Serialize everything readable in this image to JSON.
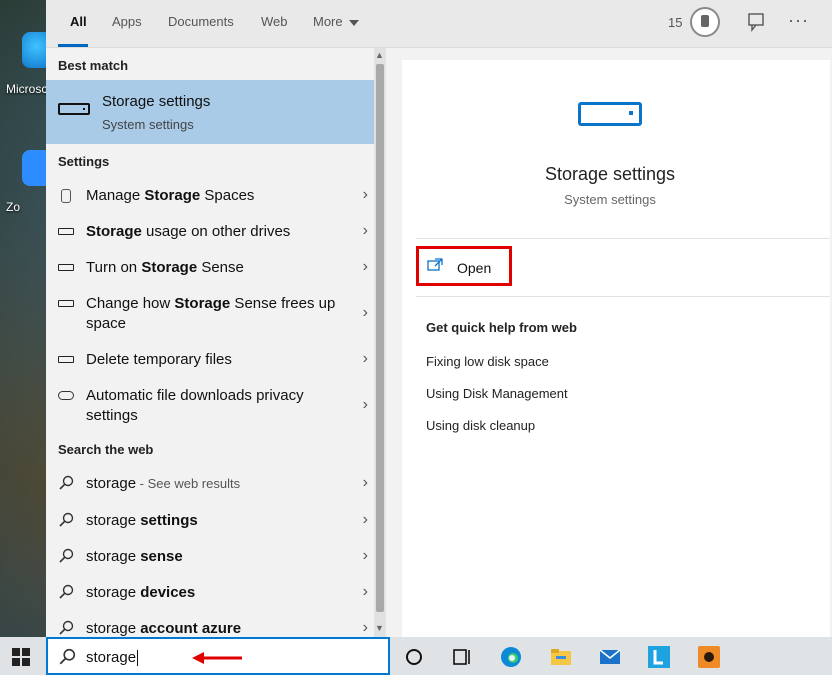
{
  "desktop": {
    "icon1_label": "Microsc",
    "icon2_label": "Zo"
  },
  "tabs": [
    {
      "label": "All"
    },
    {
      "label": "Apps"
    },
    {
      "label": "Documents"
    },
    {
      "label": "Web"
    },
    {
      "label": "More"
    }
  ],
  "header": {
    "rewards_count": "15"
  },
  "best_match": {
    "heading": "Best match",
    "title": "Storage settings",
    "subtitle": "System settings"
  },
  "settings": {
    "heading": "Settings",
    "items": [
      {
        "pre": "Manage ",
        "bold": "Storage",
        "post": " Spaces",
        "icon": "storage-spaces-icon"
      },
      {
        "pre": "",
        "bold": "Storage",
        "post": " usage on other drives",
        "icon": "drive-icon"
      },
      {
        "pre": "Turn on ",
        "bold": "Storage",
        "post": " Sense",
        "icon": "drive-icon"
      },
      {
        "pre": "Change how ",
        "bold": "Storage",
        "post": " Sense frees up space",
        "icon": "drive-icon"
      },
      {
        "pre": "Delete temporary files",
        "bold": "",
        "post": "",
        "icon": "drive-icon"
      },
      {
        "pre": "Automatic file downloads privacy settings",
        "bold": "",
        "post": "",
        "icon": "cloud-icon"
      }
    ]
  },
  "web": {
    "heading": "Search the web",
    "items": [
      {
        "pre": "storage",
        "bold": "",
        "post": "",
        "note": " - See web results"
      },
      {
        "pre": "storage ",
        "bold": "settings",
        "post": "",
        "note": ""
      },
      {
        "pre": "storage ",
        "bold": "sense",
        "post": "",
        "note": ""
      },
      {
        "pre": "storage ",
        "bold": "devices",
        "post": "",
        "note": ""
      },
      {
        "pre": "storage ",
        "bold": "account azure",
        "post": "",
        "note": ""
      }
    ]
  },
  "detail": {
    "title": "Storage settings",
    "subtitle": "System settings",
    "open_label": "Open",
    "help_heading": "Get quick help from web",
    "help_links": [
      "Fixing low disk space",
      "Using Disk Management",
      "Using disk cleanup"
    ]
  },
  "search": {
    "query": "storage"
  },
  "colors": {
    "accent": "#0078d7",
    "highlight": "#a9cbe8",
    "annotation": "#e00000"
  }
}
